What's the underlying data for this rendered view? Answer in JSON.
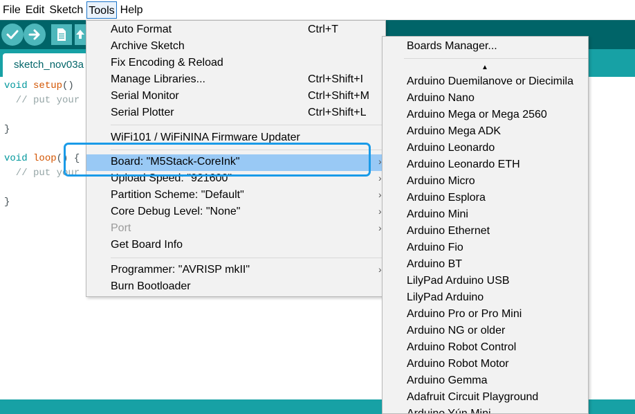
{
  "menubar": {
    "items": [
      "File",
      "Edit",
      "Sketch",
      "Tools",
      "Help"
    ],
    "active_index": 3
  },
  "toolbar": {
    "buttons": [
      "verify-icon",
      "upload-icon",
      "new-icon",
      "open-icon"
    ]
  },
  "tab": {
    "label": "sketch_nov03a"
  },
  "editor": {
    "lines": [
      {
        "kw": "void",
        "fn": "setup",
        "rest": "()"
      },
      {
        "comment": "  // put your"
      },
      {
        "plain": ""
      },
      {
        "plain": "}"
      },
      {
        "plain": ""
      },
      {
        "kw": "void",
        "fn": "loop",
        "rest": "() {"
      },
      {
        "comment": "  // put your"
      },
      {
        "plain": ""
      },
      {
        "plain": "}"
      }
    ]
  },
  "tools_menu": {
    "group1": [
      {
        "label": "Auto Format",
        "shortcut": "Ctrl+T"
      },
      {
        "label": "Archive Sketch",
        "shortcut": ""
      },
      {
        "label": "Fix Encoding & Reload",
        "shortcut": ""
      },
      {
        "label": "Manage Libraries...",
        "shortcut": "Ctrl+Shift+I"
      },
      {
        "label": "Serial Monitor",
        "shortcut": "Ctrl+Shift+M"
      },
      {
        "label": "Serial Plotter",
        "shortcut": "Ctrl+Shift+L"
      }
    ],
    "updater": "WiFi101 / WiFiNINA Firmware Updater",
    "group3": [
      {
        "label": "Board: \"M5Stack-CoreInk\"",
        "submenu": true,
        "highlighted": true
      },
      {
        "label": "Upload Speed: \"921600\"",
        "submenu": true
      },
      {
        "label": "Partition Scheme: \"Default\"",
        "submenu": true
      },
      {
        "label": "Core Debug Level: \"None\"",
        "submenu": true
      },
      {
        "label": "Port",
        "submenu": true,
        "disabled": true
      },
      {
        "label": "Get Board Info"
      }
    ],
    "group4": [
      {
        "label": "Programmer: \"AVRISP mkII\"",
        "submenu": true
      },
      {
        "label": "Burn Bootloader"
      }
    ],
    "submenu_arrow": "›"
  },
  "boards_menu": {
    "manager": "Boards Manager...",
    "scroll_up": "▲",
    "boards": [
      "Arduino Duemilanove or Diecimila",
      "Arduino Nano",
      "Arduino Mega or Mega 2560",
      "Arduino Mega ADK",
      "Arduino Leonardo",
      "Arduino Leonardo ETH",
      "Arduino Micro",
      "Arduino Esplora",
      "Arduino Mini",
      "Arduino Ethernet",
      "Arduino Fio",
      "Arduino BT",
      "LilyPad Arduino USB",
      "LilyPad Arduino",
      "Arduino Pro or Pro Mini",
      "Arduino NG or older",
      "Arduino Robot Control",
      "Arduino Robot Motor",
      "Arduino Gemma",
      "Adafruit Circuit Playground",
      "Arduino Yún Mini"
    ]
  },
  "colors": {
    "toolbar": "#006468",
    "tabbar": "#17a1a5",
    "button": "#4db7bb",
    "highlight": "#99c9f5",
    "callout": "#1a9be8"
  }
}
